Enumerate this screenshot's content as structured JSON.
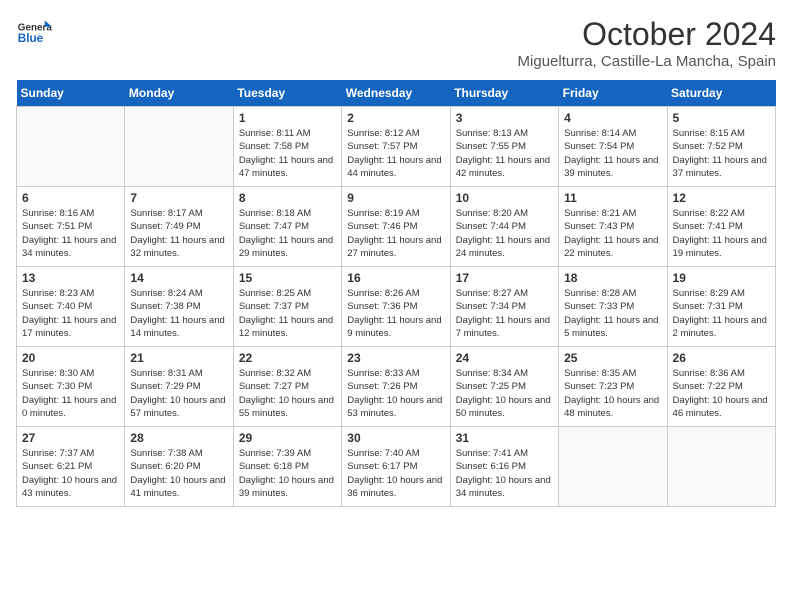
{
  "header": {
    "logo_general": "General",
    "logo_blue": "Blue",
    "month": "October 2024",
    "location": "Miguelturra, Castille-La Mancha, Spain"
  },
  "days_of_week": [
    "Sunday",
    "Monday",
    "Tuesday",
    "Wednesday",
    "Thursday",
    "Friday",
    "Saturday"
  ],
  "weeks": [
    [
      {
        "day": "",
        "info": ""
      },
      {
        "day": "",
        "info": ""
      },
      {
        "day": "1",
        "info": "Sunrise: 8:11 AM\nSunset: 7:58 PM\nDaylight: 11 hours and 47 minutes."
      },
      {
        "day": "2",
        "info": "Sunrise: 8:12 AM\nSunset: 7:57 PM\nDaylight: 11 hours and 44 minutes."
      },
      {
        "day": "3",
        "info": "Sunrise: 8:13 AM\nSunset: 7:55 PM\nDaylight: 11 hours and 42 minutes."
      },
      {
        "day": "4",
        "info": "Sunrise: 8:14 AM\nSunset: 7:54 PM\nDaylight: 11 hours and 39 minutes."
      },
      {
        "day": "5",
        "info": "Sunrise: 8:15 AM\nSunset: 7:52 PM\nDaylight: 11 hours and 37 minutes."
      }
    ],
    [
      {
        "day": "6",
        "info": "Sunrise: 8:16 AM\nSunset: 7:51 PM\nDaylight: 11 hours and 34 minutes."
      },
      {
        "day": "7",
        "info": "Sunrise: 8:17 AM\nSunset: 7:49 PM\nDaylight: 11 hours and 32 minutes."
      },
      {
        "day": "8",
        "info": "Sunrise: 8:18 AM\nSunset: 7:47 PM\nDaylight: 11 hours and 29 minutes."
      },
      {
        "day": "9",
        "info": "Sunrise: 8:19 AM\nSunset: 7:46 PM\nDaylight: 11 hours and 27 minutes."
      },
      {
        "day": "10",
        "info": "Sunrise: 8:20 AM\nSunset: 7:44 PM\nDaylight: 11 hours and 24 minutes."
      },
      {
        "day": "11",
        "info": "Sunrise: 8:21 AM\nSunset: 7:43 PM\nDaylight: 11 hours and 22 minutes."
      },
      {
        "day": "12",
        "info": "Sunrise: 8:22 AM\nSunset: 7:41 PM\nDaylight: 11 hours and 19 minutes."
      }
    ],
    [
      {
        "day": "13",
        "info": "Sunrise: 8:23 AM\nSunset: 7:40 PM\nDaylight: 11 hours and 17 minutes."
      },
      {
        "day": "14",
        "info": "Sunrise: 8:24 AM\nSunset: 7:38 PM\nDaylight: 11 hours and 14 minutes."
      },
      {
        "day": "15",
        "info": "Sunrise: 8:25 AM\nSunset: 7:37 PM\nDaylight: 11 hours and 12 minutes."
      },
      {
        "day": "16",
        "info": "Sunrise: 8:26 AM\nSunset: 7:36 PM\nDaylight: 11 hours and 9 minutes."
      },
      {
        "day": "17",
        "info": "Sunrise: 8:27 AM\nSunset: 7:34 PM\nDaylight: 11 hours and 7 minutes."
      },
      {
        "day": "18",
        "info": "Sunrise: 8:28 AM\nSunset: 7:33 PM\nDaylight: 11 hours and 5 minutes."
      },
      {
        "day": "19",
        "info": "Sunrise: 8:29 AM\nSunset: 7:31 PM\nDaylight: 11 hours and 2 minutes."
      }
    ],
    [
      {
        "day": "20",
        "info": "Sunrise: 8:30 AM\nSunset: 7:30 PM\nDaylight: 11 hours and 0 minutes."
      },
      {
        "day": "21",
        "info": "Sunrise: 8:31 AM\nSunset: 7:29 PM\nDaylight: 10 hours and 57 minutes."
      },
      {
        "day": "22",
        "info": "Sunrise: 8:32 AM\nSunset: 7:27 PM\nDaylight: 10 hours and 55 minutes."
      },
      {
        "day": "23",
        "info": "Sunrise: 8:33 AM\nSunset: 7:26 PM\nDaylight: 10 hours and 53 minutes."
      },
      {
        "day": "24",
        "info": "Sunrise: 8:34 AM\nSunset: 7:25 PM\nDaylight: 10 hours and 50 minutes."
      },
      {
        "day": "25",
        "info": "Sunrise: 8:35 AM\nSunset: 7:23 PM\nDaylight: 10 hours and 48 minutes."
      },
      {
        "day": "26",
        "info": "Sunrise: 8:36 AM\nSunset: 7:22 PM\nDaylight: 10 hours and 46 minutes."
      }
    ],
    [
      {
        "day": "27",
        "info": "Sunrise: 7:37 AM\nSunset: 6:21 PM\nDaylight: 10 hours and 43 minutes."
      },
      {
        "day": "28",
        "info": "Sunrise: 7:38 AM\nSunset: 6:20 PM\nDaylight: 10 hours and 41 minutes."
      },
      {
        "day": "29",
        "info": "Sunrise: 7:39 AM\nSunset: 6:18 PM\nDaylight: 10 hours and 39 minutes."
      },
      {
        "day": "30",
        "info": "Sunrise: 7:40 AM\nSunset: 6:17 PM\nDaylight: 10 hours and 36 minutes."
      },
      {
        "day": "31",
        "info": "Sunrise: 7:41 AM\nSunset: 6:16 PM\nDaylight: 10 hours and 34 minutes."
      },
      {
        "day": "",
        "info": ""
      },
      {
        "day": "",
        "info": ""
      }
    ]
  ]
}
